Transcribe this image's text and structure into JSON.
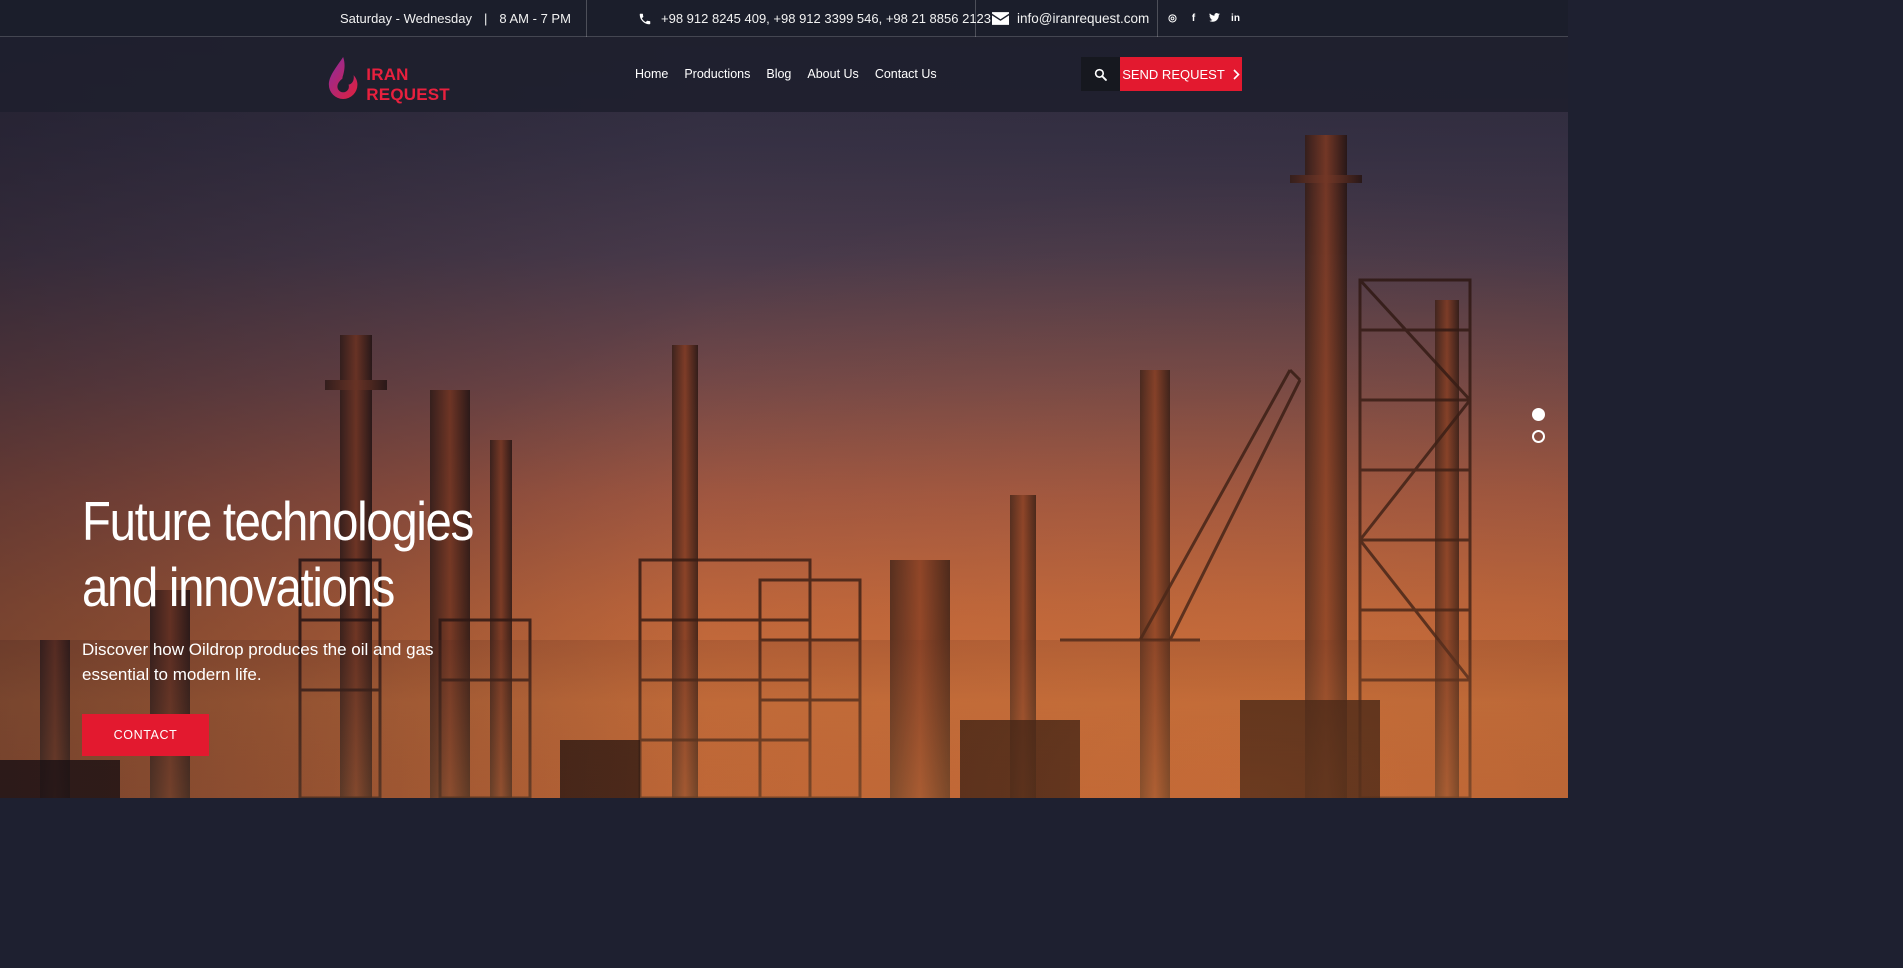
{
  "topbar": {
    "days": "Saturday - Wednesday",
    "separator": "|",
    "hours": "8 AM - 7 PM",
    "phones": "+98 912 8245 409, +98 912 3399 546, +98 21 8856 2123",
    "email": "info@iranrequest.com",
    "social": [
      {
        "name": "instagram",
        "glyph": "◎"
      },
      {
        "name": "facebook",
        "glyph": "f"
      },
      {
        "name": "twitter",
        "glyph": "t"
      },
      {
        "name": "linkedin",
        "glyph": "in"
      }
    ]
  },
  "header": {
    "logo_text": "IRAN REQUEST",
    "nav": [
      "Home",
      "Productions",
      "Blog",
      "About Us",
      "Contact Us"
    ],
    "send_request_label": "SEND REQUEST"
  },
  "hero": {
    "headline": "Future technologies and innovations",
    "subtext": "Discover how Oildrop produces the oil and gas essential to modern life.",
    "cta_label": "CONTACT",
    "slides_total": 2,
    "active_slide": 1
  },
  "colors": {
    "accent": "#e3192f",
    "logo_purple": "#9b2a8f",
    "topbar_bg": "#1b1e2b"
  }
}
